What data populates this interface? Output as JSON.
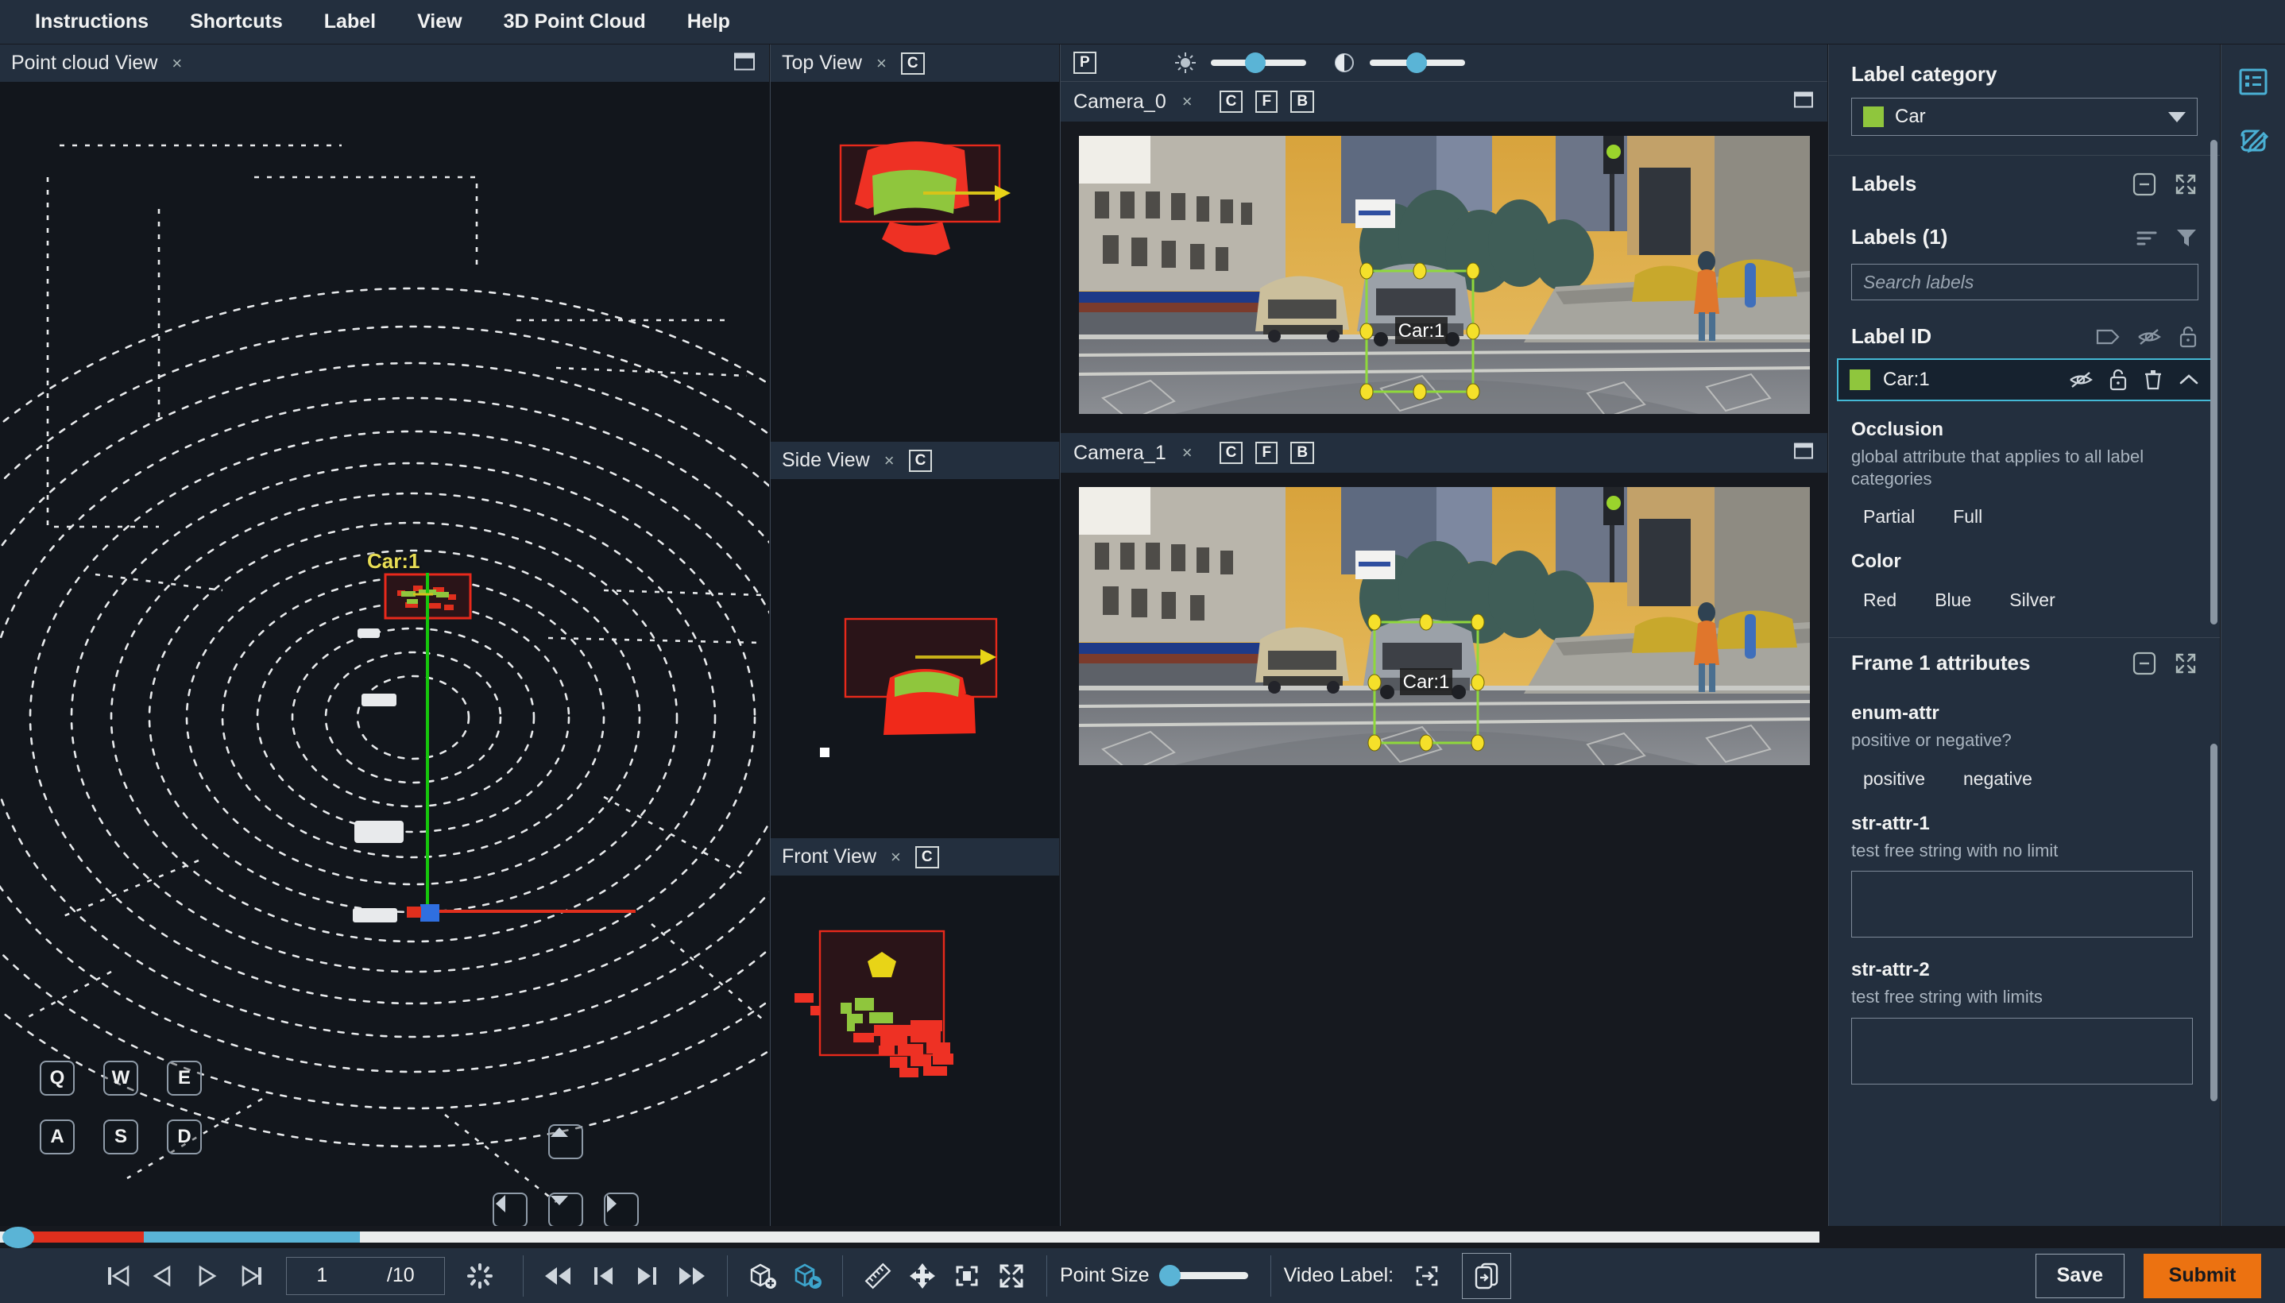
{
  "menu": {
    "items": [
      {
        "label": "Instructions",
        "name": "menu-instructions"
      },
      {
        "label": "Shortcuts",
        "name": "menu-shortcuts"
      },
      {
        "label": "Label",
        "name": "menu-label"
      },
      {
        "label": "View",
        "name": "menu-view"
      },
      {
        "label": "3D Point Cloud",
        "name": "menu-3d-point-cloud"
      },
      {
        "label": "Help",
        "name": "menu-help"
      }
    ]
  },
  "point_cloud": {
    "title": "Point cloud View",
    "close": "×",
    "keys": {
      "q": "Q",
      "w": "W",
      "e": "E",
      "a": "A",
      "s": "S",
      "d": "D"
    },
    "object_label": "Car:1"
  },
  "mini_views": [
    {
      "title": "Top View",
      "badge": "C",
      "name": "top-view"
    },
    {
      "title": "Side View",
      "badge": "C",
      "name": "side-view"
    },
    {
      "title": "Front View",
      "badge": "C",
      "name": "front-view"
    }
  ],
  "camera_toolbar": {
    "projection_badge": "P",
    "brightness_icon": "sun-icon",
    "contrast_icon": "contrast-icon",
    "brightness_value": 50,
    "contrast_value": 50
  },
  "cameras": [
    {
      "title": "Camera_0",
      "close": "×",
      "badges": [
        "C",
        "F",
        "B"
      ],
      "box_label": "Car:1"
    },
    {
      "title": "Camera_1",
      "close": "×",
      "badges": [
        "C",
        "F",
        "B"
      ],
      "box_label": "Car:1"
    }
  ],
  "playback": {
    "skip_start_icon": "skip-to-start-icon",
    "step_back_icon": "step-back-icon",
    "play_icon": "play-icon",
    "step_forward_icon": "step-forward-icon",
    "current_frame": "1",
    "total_frames": "/10",
    "loading_icon": "spinner-icon"
  },
  "bottom_toolbar": {
    "fast_rewind_icon": "fast-rewind-icon",
    "prev_frame_icon": "previous-frame-icon",
    "next_frame_icon": "next-frame-icon",
    "fast_forward_icon": "fast-forward-icon",
    "add_cuboid_icon": "add-cuboid-icon",
    "fit_cuboid_icon": "fit-cuboid-icon",
    "ruler_icon": "ruler-icon",
    "move_icon": "move-icon",
    "fit_view_icon": "fit-to-view-icon",
    "fullscreen_icon": "fullscreen-icon",
    "point_size_label": "Point Size",
    "point_size_value": 12,
    "video_label_label": "Video Label:",
    "video_label_icon": "label-frame-icon",
    "copy_label_icon": "copy-to-next-frame-icon",
    "save_label": "Save",
    "submit_label": "Submit"
  },
  "sidebar": {
    "label_category": {
      "heading": "Label category",
      "selected": "Car",
      "color": "#8fc63d"
    },
    "labels_panel": {
      "heading": "Labels",
      "collapse_icon": "collapse-icon",
      "expand_icon": "expand-icon"
    },
    "labels_list": {
      "heading": "Labels (1)",
      "sort_icon": "sort-icon",
      "filter_icon": "filter-icon",
      "search_placeholder": "Search labels",
      "search_value": ""
    },
    "label_id": {
      "heading": "Label ID",
      "tag_icon": "tag-icon",
      "hide_icon": "eye-off-icon",
      "lock_icon": "unlock-icon"
    },
    "label_rows": [
      {
        "name": "Car:1",
        "color": "#8fc63d",
        "hide_icon": "eye-off-icon",
        "lock_icon": "unlock-icon",
        "delete_icon": "trash-icon",
        "collapse_icon": "chevron-up-icon",
        "selected": true
      }
    ],
    "label_attributes": [
      {
        "name": "Occlusion",
        "description": "global attribute that applies to all label categories",
        "options": [
          "Partial",
          "Full"
        ]
      },
      {
        "name": "Color",
        "description": "",
        "options": [
          "Red",
          "Blue",
          "Silver"
        ]
      }
    ],
    "frame_attributes": {
      "heading": "Frame 1 attributes",
      "collapse_icon": "collapse-icon",
      "expand_icon": "expand-icon",
      "items": [
        {
          "name": "enum-attr",
          "description": "positive or negative?",
          "type": "enum",
          "options": [
            "positive",
            "negative"
          ]
        },
        {
          "name": "str-attr-1",
          "description": "test free string with no limit",
          "type": "textarea",
          "value": ""
        },
        {
          "name": "str-attr-2",
          "description": "test free string with limits",
          "type": "textarea",
          "value": ""
        }
      ]
    }
  },
  "rail": {
    "items": [
      {
        "icon": "list-view-icon",
        "name": "rail-list-view"
      },
      {
        "icon": "edit-icon",
        "name": "rail-edit"
      }
    ]
  }
}
